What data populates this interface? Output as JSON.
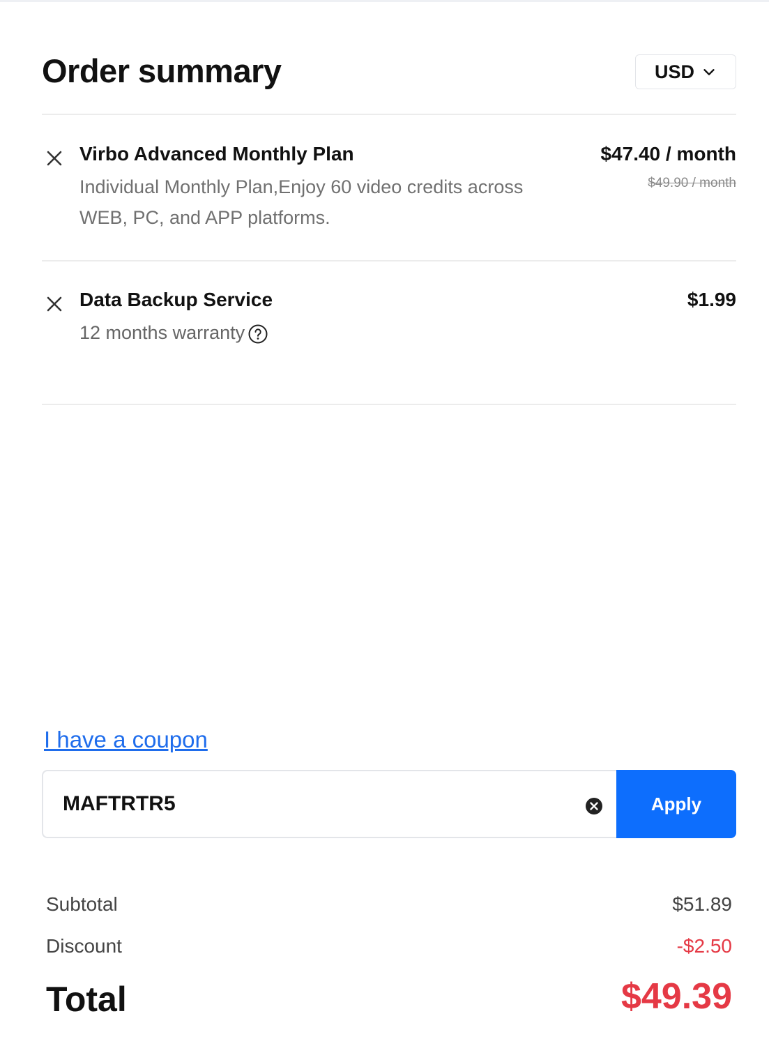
{
  "header": {
    "title": "Order summary",
    "currency": "USD"
  },
  "items": [
    {
      "name": "Virbo Advanced Monthly Plan",
      "description": "Individual Monthly Plan,Enjoy 60 video credits across WEB, PC, and APP platforms.",
      "price": "$47.40 / month",
      "original_price": "$49.90 / month"
    },
    {
      "name": "Data Backup Service",
      "description": "12 months warranty",
      "price": "$1.99"
    }
  ],
  "coupon": {
    "link_label": "I have a coupon",
    "value": "MAFTRTR5",
    "apply_label": "Apply"
  },
  "summary": {
    "subtotal_label": "Subtotal",
    "subtotal_value": "$51.89",
    "discount_label": "Discount",
    "discount_value": "-$2.50",
    "total_label": "Total",
    "total_value": "$49.39"
  },
  "colors": {
    "accent": "#0d6efd",
    "link": "#1f6dec",
    "price_red": "#e53945"
  },
  "icons": [
    "chevron-down-icon",
    "close-icon",
    "help-circle-icon",
    "clear-circle-icon"
  ]
}
